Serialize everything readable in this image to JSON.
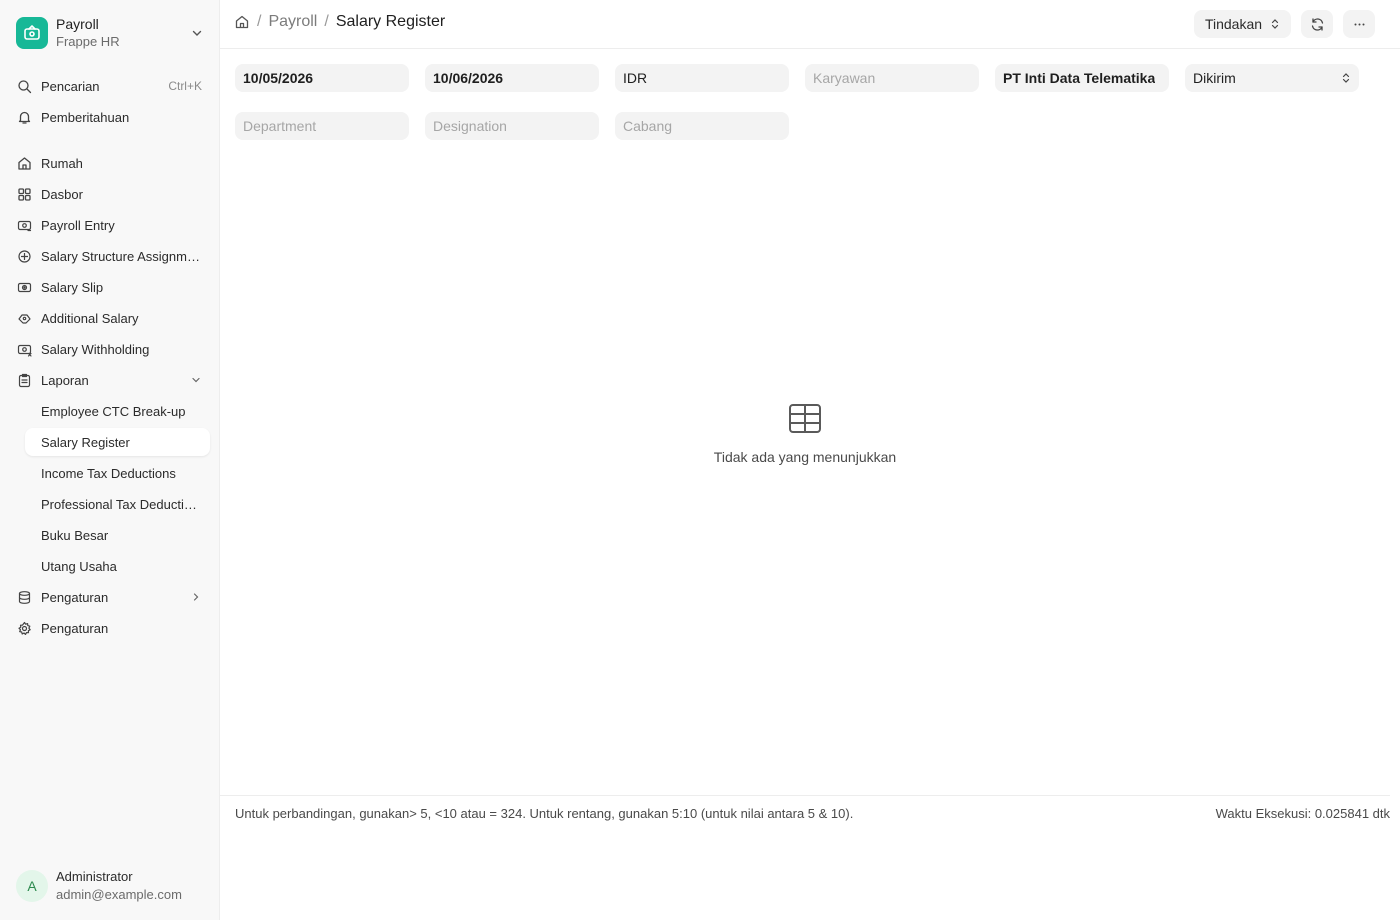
{
  "app": {
    "title": "Payroll",
    "subtitle": "Frappe HR"
  },
  "sidebar": {
    "search": {
      "label": "Pencarian",
      "shortcut": "Ctrl+K"
    },
    "notifications": {
      "label": "Pemberitahuan"
    },
    "items": [
      {
        "label": "Rumah",
        "icon": "home-icon"
      },
      {
        "label": "Dasbor",
        "icon": "dashboard-icon"
      },
      {
        "label": "Payroll Entry",
        "icon": "money-icon"
      },
      {
        "label": "Salary Structure Assignment",
        "icon": "structure-icon"
      },
      {
        "label": "Salary Slip",
        "icon": "slip-icon"
      },
      {
        "label": "Additional Salary",
        "icon": "gift-icon"
      },
      {
        "label": "Salary Withholding",
        "icon": "withholding-icon"
      },
      {
        "label": "Laporan",
        "icon": "report-icon"
      }
    ],
    "reports": [
      "Employee CTC Break-up",
      "Salary Register",
      "Income Tax Deductions",
      "Professional Tax Deductions",
      "Buku Besar",
      "Utang Usaha"
    ],
    "bottom_items": [
      {
        "label": "Pengaturan",
        "icon": "database-icon"
      },
      {
        "label": "Pengaturan",
        "icon": "gear-icon"
      }
    ]
  },
  "user": {
    "initial": "A",
    "name": "Administrator",
    "email": "admin@example.com"
  },
  "breadcrumb": {
    "parent": "Payroll",
    "current": "Salary Register"
  },
  "header": {
    "actions_label": "Tindakan"
  },
  "filters": {
    "from_date": "10/05/2026",
    "to_date": "10/06/2026",
    "currency": "IDR",
    "employee_placeholder": "Karyawan",
    "company": "PT Inti Data Telematika",
    "docstatus": "Dikirim",
    "department_placeholder": "Department",
    "designation_placeholder": "Designation",
    "branch_placeholder": "Cabang"
  },
  "empty_state": {
    "message": "Tidak ada yang menunjukkan"
  },
  "footer": {
    "hint": "Untuk perbandingan, gunakan> 5, <10 atau = 324. Untuk rentang, gunakan 5:10 (untuk nilai antara 5 & 10).",
    "execution": "Waktu Eksekusi: 0.025841 dtk"
  },
  "colors": {
    "brand": "#17b897",
    "sidebar_bg": "#f8f8f8",
    "field_bg": "#f3f3f3"
  }
}
